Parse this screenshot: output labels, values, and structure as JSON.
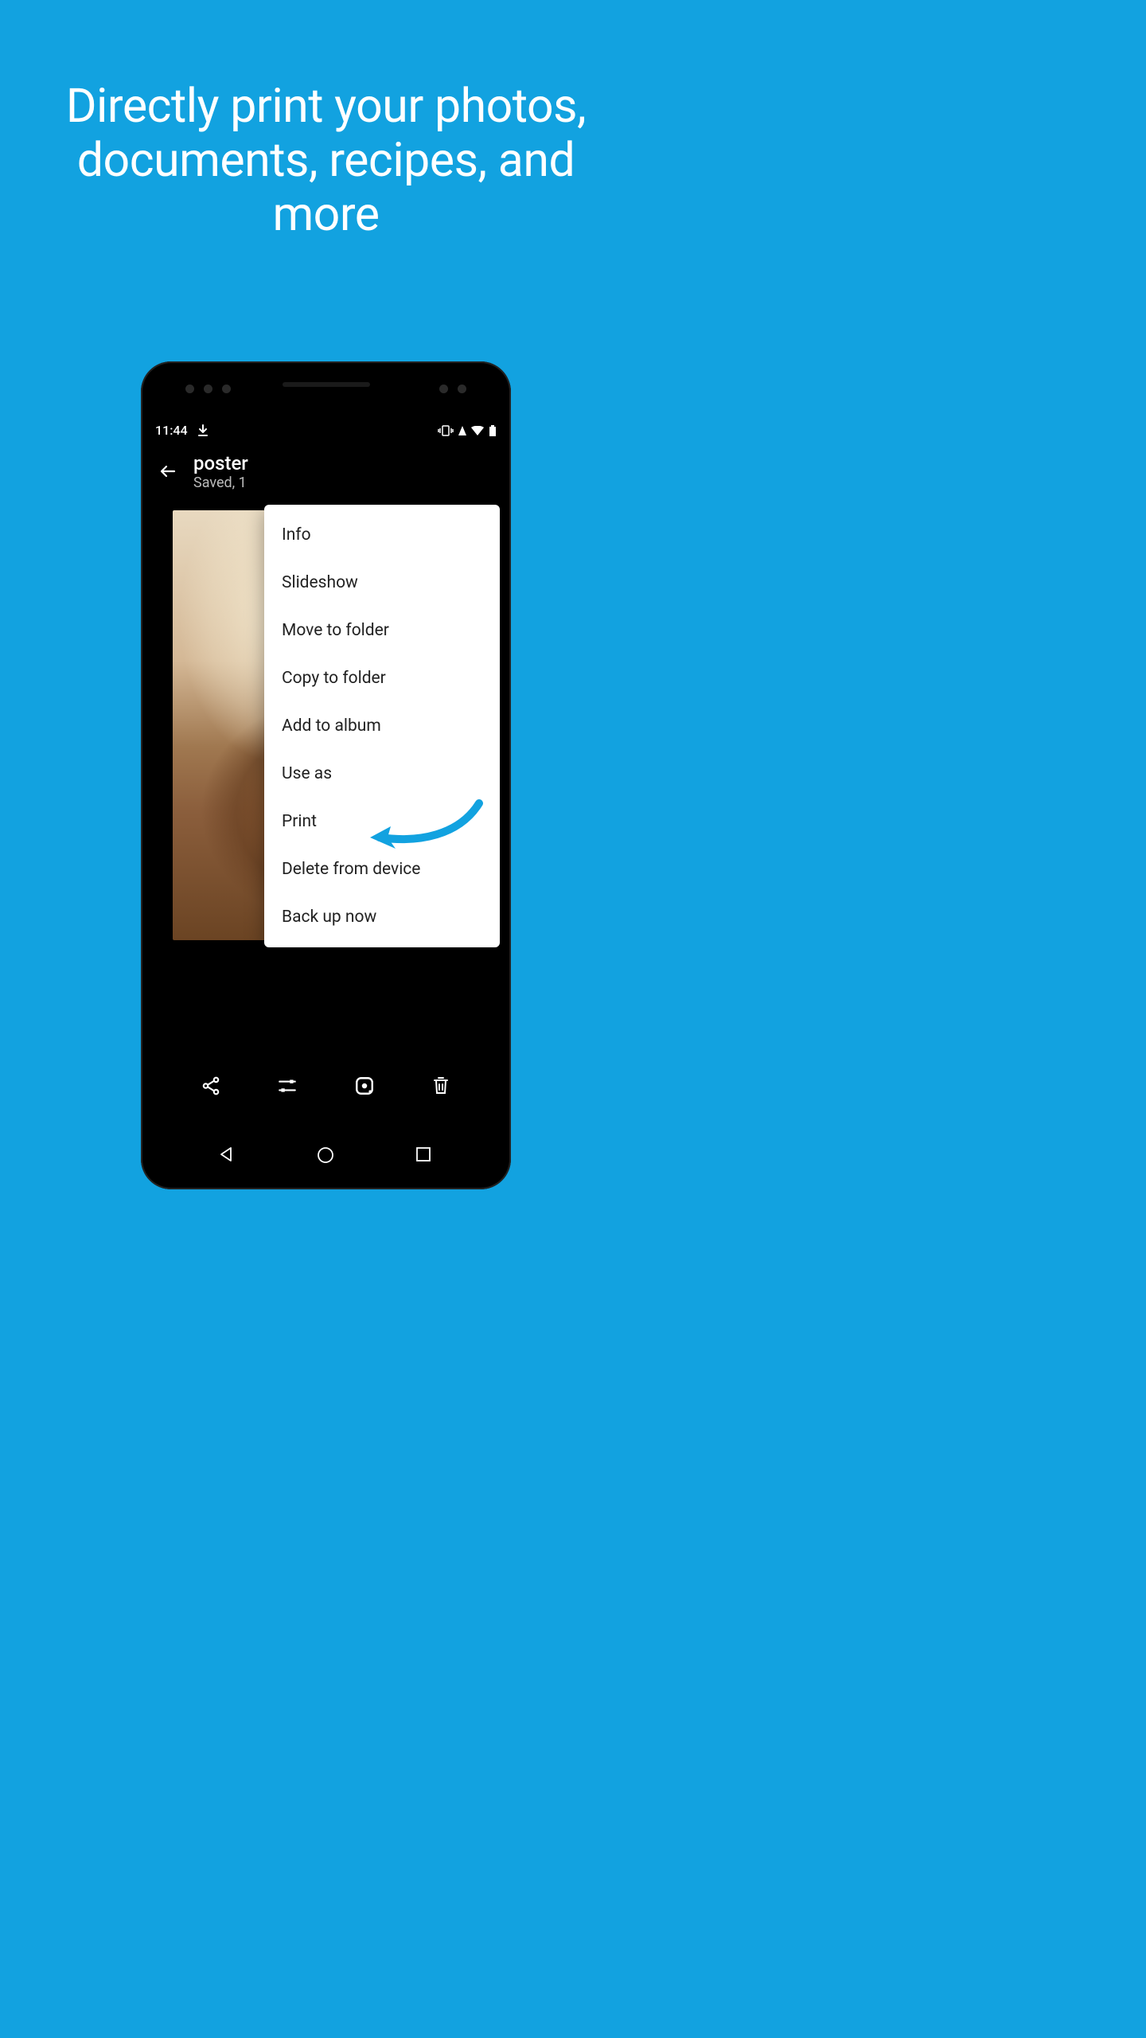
{
  "headline": "Directly print your photos, documents, recipes, and more",
  "statusbar": {
    "time": "11:44"
  },
  "appbar": {
    "title": "poster",
    "subtitle": "Saved, 1"
  },
  "menu": {
    "items": [
      "Info",
      "Slideshow",
      "Move to folder",
      "Copy to folder",
      "Add to album",
      "Use as",
      "Print",
      "Delete from device",
      "Back up now"
    ]
  }
}
